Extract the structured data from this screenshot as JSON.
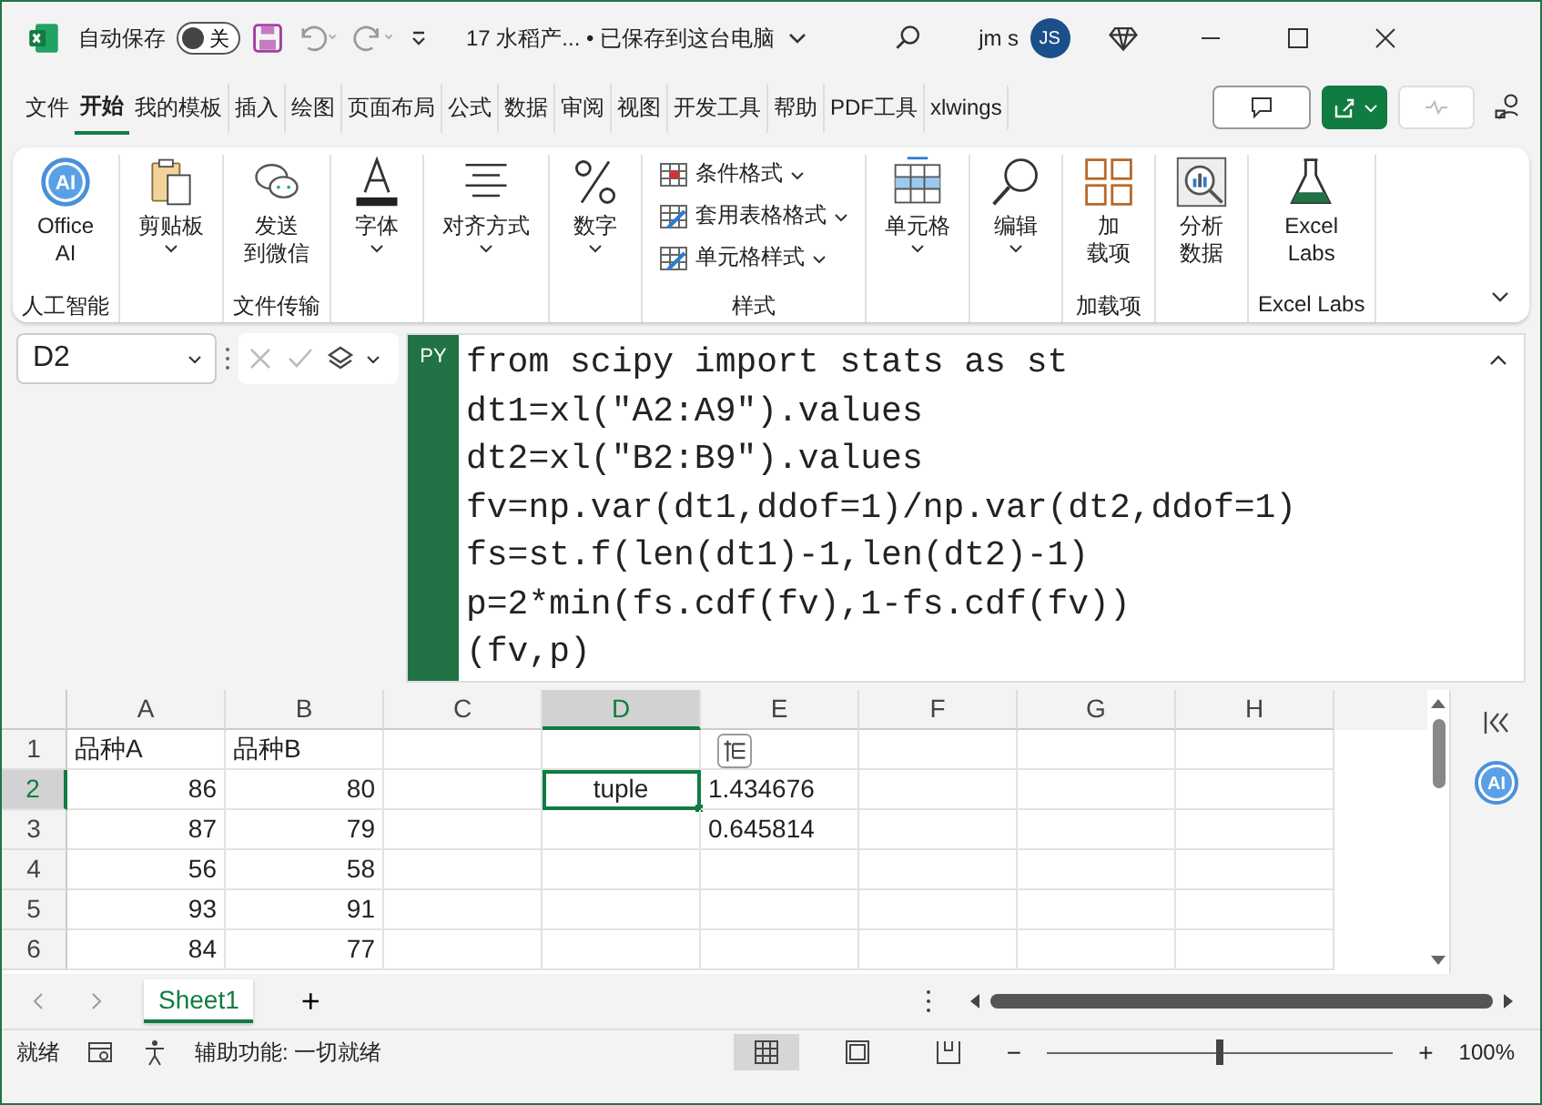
{
  "title_bar": {
    "autosave_label": "自动保存",
    "autosave_toggle": {
      "label": "关",
      "on": false
    },
    "document_title": "17 水稻产... • 已保存到这台电脑",
    "user_name": "jm s",
    "avatar_initials": "JS"
  },
  "menu_tabs": [
    {
      "label": "文件",
      "selected": false
    },
    {
      "label": "开始",
      "selected": true
    },
    {
      "label": "我的模板",
      "selected": false
    },
    {
      "label": "插入",
      "selected": false
    },
    {
      "label": "绘图",
      "selected": false
    },
    {
      "label": "页面布局",
      "selected": false
    },
    {
      "label": "公式",
      "selected": false
    },
    {
      "label": "数据",
      "selected": false
    },
    {
      "label": "审阅",
      "selected": false
    },
    {
      "label": "视图",
      "selected": false
    },
    {
      "label": "开发工具",
      "selected": false
    },
    {
      "label": "帮助",
      "selected": false
    },
    {
      "label": "PDF工具",
      "selected": false
    },
    {
      "label": "xlwings",
      "selected": false
    }
  ],
  "ribbon_groups": [
    {
      "label": "人工智能",
      "buttons": [
        {
          "kind": "ai",
          "icon_text": "AI",
          "lines": [
            "Office",
            "AI"
          ],
          "dropdown": false
        }
      ]
    },
    {
      "buttons": [
        {
          "kind": "clipboard",
          "lines": [
            "剪贴板"
          ],
          "dropdown": true
        }
      ]
    },
    {
      "label": "文件传输",
      "buttons": [
        {
          "kind": "chat",
          "lines": [
            "发送",
            "到微信"
          ],
          "dropdown": false
        }
      ]
    },
    {
      "buttons": [
        {
          "kind": "font",
          "lines": [
            "字体"
          ],
          "dropdown": true
        }
      ]
    },
    {
      "buttons": [
        {
          "kind": "align",
          "lines": [
            "对齐方式"
          ],
          "dropdown": true
        }
      ]
    },
    {
      "buttons": [
        {
          "kind": "number",
          "lines": [
            "数字"
          ],
          "dropdown": true
        }
      ]
    },
    {
      "label": "样式",
      "buttons": [
        {
          "kind": "list",
          "items": [
            "条件格式",
            "套用表格格式",
            "单元格样式"
          ]
        }
      ]
    },
    {
      "buttons": [
        {
          "kind": "cells",
          "lines": [
            "单元格"
          ],
          "dropdown": true
        }
      ]
    },
    {
      "buttons": [
        {
          "kind": "search",
          "lines": [
            "编辑"
          ],
          "dropdown": true
        }
      ]
    },
    {
      "label": "加载项",
      "buttons": [
        {
          "kind": "addins",
          "lines": [
            "加",
            "载项"
          ],
          "dropdown": false
        }
      ]
    },
    {
      "buttons": [
        {
          "kind": "analyze",
          "lines": [
            "分析",
            "数据"
          ],
          "dropdown": false
        }
      ]
    },
    {
      "label": "Excel Labs",
      "buttons": [
        {
          "kind": "flask",
          "lines": [
            "Excel",
            "Labs"
          ],
          "dropdown": false
        }
      ]
    }
  ],
  "formula_bar": {
    "name_box": "D2",
    "badge": "PY",
    "code_lines": [
      "from scipy import stats as st",
      "dt1=xl(\"A2:A9\").values",
      "dt2=xl(\"B2:B9\").values",
      "fv=np.var(dt1,ddof=1)/np.var(dt2,ddof=1)",
      "fs=st.f(len(dt1)-1,len(dt2)-1)",
      "p=2*min(fs.cdf(fv),1-fs.cdf(fv))",
      "(fv,p)"
    ]
  },
  "grid": {
    "columns": [
      {
        "label": "A",
        "selected": false
      },
      {
        "label": "B",
        "selected": false
      },
      {
        "label": "C",
        "selected": false
      },
      {
        "label": "D",
        "selected": true
      },
      {
        "label": "E",
        "selected": false
      },
      {
        "label": "F",
        "selected": false
      },
      {
        "label": "G",
        "selected": false
      },
      {
        "label": "H",
        "selected": false
      }
    ],
    "rows": [
      {
        "number": "1",
        "selected": false,
        "cells": [
          {
            "text": "品种A",
            "kind": "text",
            "selected": false
          },
          {
            "text": "品种B",
            "kind": "text",
            "selected": false
          },
          null,
          null,
          null,
          null,
          null,
          null
        ]
      },
      {
        "number": "2",
        "selected": true,
        "cells": [
          {
            "text": "86",
            "kind": "number",
            "selected": false
          },
          {
            "text": "80",
            "kind": "number",
            "selected": false
          },
          null,
          {
            "text": "tuple",
            "kind": "python",
            "selected": true
          },
          {
            "text": "1.434676",
            "kind": "text",
            "selected": false
          },
          null,
          null,
          null
        ]
      },
      {
        "number": "3",
        "selected": false,
        "cells": [
          {
            "text": "87",
            "kind": "number",
            "selected": false
          },
          {
            "text": "79",
            "kind": "number",
            "selected": false
          },
          null,
          null,
          {
            "text": "0.645814",
            "kind": "text",
            "selected": false
          },
          null,
          null,
          null
        ]
      },
      {
        "number": "4",
        "selected": false,
        "cells": [
          {
            "text": "56",
            "kind": "number",
            "selected": false
          },
          {
            "text": "58",
            "kind": "number",
            "selected": false
          },
          null,
          null,
          null,
          null,
          null,
          null
        ]
      },
      {
        "number": "5",
        "selected": false,
        "cells": [
          {
            "text": "93",
            "kind": "number",
            "selected": false
          },
          {
            "text": "91",
            "kind": "number",
            "selected": false
          },
          null,
          null,
          null,
          null,
          null,
          null
        ]
      },
      {
        "number": "6",
        "selected": false,
        "cells": [
          {
            "text": "84",
            "kind": "number",
            "selected": false
          },
          {
            "text": "77",
            "kind": "number",
            "selected": false
          },
          null,
          null,
          null,
          null,
          null,
          null
        ]
      }
    ]
  },
  "side_pane": {
    "ai_icon_text": "AI"
  },
  "sheet_tabs": [
    {
      "label": "Sheet1",
      "selected": true
    }
  ],
  "add_sheet": "+",
  "status_bar": {
    "ready": "就绪",
    "accessibility": "辅助功能: 一切就绪",
    "views": [
      {
        "kind": "normal",
        "selected": true
      },
      {
        "kind": "page",
        "selected": false
      },
      {
        "kind": "break",
        "selected": false
      }
    ],
    "zoom_minus": "−",
    "zoom_slider": {
      "level": 0.5
    },
    "zoom_plus": "+",
    "zoom": "100%"
  }
}
